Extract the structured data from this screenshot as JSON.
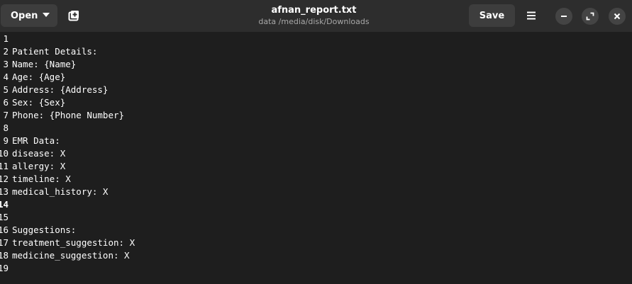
{
  "header": {
    "open_label": "Open",
    "title": "afnan_report.txt",
    "path": "data /media/disk/Downloads",
    "save_label": "Save"
  },
  "icons": {
    "open_caret": "chevron-down-icon",
    "new_tab": "new-tab-icon",
    "menu": "hamburger-menu-icon",
    "minimize": "minimize-icon",
    "maximize": "maximize-icon",
    "close": "close-icon"
  },
  "colors": {
    "background": "#1e1e1e",
    "header": "#2d2d2d",
    "button": "#3d3d3d",
    "text": "#ffffff"
  },
  "editor": {
    "current_line": 14,
    "lines": [
      {
        "num": "1",
        "text": ""
      },
      {
        "num": "2",
        "text": "Patient Details:"
      },
      {
        "num": "3",
        "text": "Name: {Name}"
      },
      {
        "num": "4",
        "text": "Age: {Age}"
      },
      {
        "num": "5",
        "text": "Address: {Address}"
      },
      {
        "num": "6",
        "text": "Sex: {Sex}"
      },
      {
        "num": "7",
        "text": "Phone: {Phone Number}"
      },
      {
        "num": "8",
        "text": ""
      },
      {
        "num": "9",
        "text": "EMR Data:"
      },
      {
        "num": "10",
        "text": "disease: X"
      },
      {
        "num": "11",
        "text": "allergy: X"
      },
      {
        "num": "12",
        "text": "timeline: X"
      },
      {
        "num": "13",
        "text": "medical_history: X"
      },
      {
        "num": "14",
        "text": ""
      },
      {
        "num": "15",
        "text": ""
      },
      {
        "num": "16",
        "text": "Suggestions:"
      },
      {
        "num": "17",
        "text": "treatment_suggestion: X"
      },
      {
        "num": "18",
        "text": "medicine_suggestion: X"
      },
      {
        "num": "19",
        "text": ""
      }
    ]
  }
}
